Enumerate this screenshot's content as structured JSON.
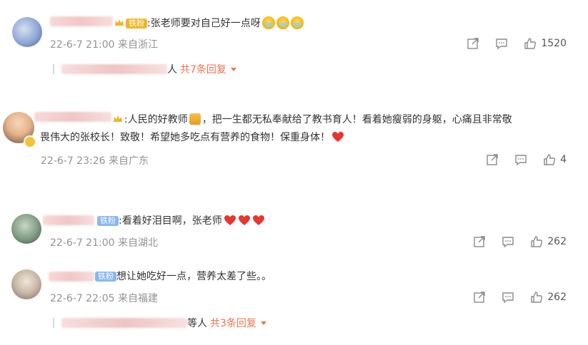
{
  "comments": [
    {
      "badge": "铁粉",
      "text": ":张老师要对自己好一点呀",
      "date": "22-6-7 21:00",
      "location": "来自浙江",
      "likes": "1520",
      "reply_suffix": "人",
      "reply_label": "共7条回复"
    },
    {
      "text_line1": ":人民的好教师",
      "text_line1_rest": "，把一生都无私奉献给了教书育人！看着她瘦弱的身躯，心痛且非常敬",
      "text_line2": "畏伟大的张校长！致敬！希望她多吃点有营养的食物！保重身体！",
      "date": "22-6-7 23:26",
      "location": "来自广东",
      "likes": "4"
    },
    {
      "badge": "铁粉",
      "text": ":看着好泪目啊，张老师",
      "date": "22-6-7 21:00",
      "location": "来自湖北",
      "likes": "262"
    },
    {
      "badge": "铁粉",
      "text": "想让她吃好一点，营养太差了些。。",
      "date": "22-6-7 22:05",
      "location": "来自福建",
      "likes": "262",
      "reply_suffix": "等人",
      "reply_label": "共3条回复"
    }
  ],
  "icons": {
    "share": "share-icon",
    "comment": "comment-icon",
    "like": "thumbs-up-icon",
    "expand": "caret-down-icon",
    "emoji_cry": "crying-face-emoji",
    "emoji_heart": "red-heart-emoji",
    "emoji_teacher": "teacher-emoji",
    "crown": "crown-icon"
  },
  "colors": {
    "accent": "#eb7350",
    "meta": "#939393",
    "badge_gold": "#f1b52a",
    "badge_blue": "#8ab6f2",
    "heart": "#e8362f"
  }
}
